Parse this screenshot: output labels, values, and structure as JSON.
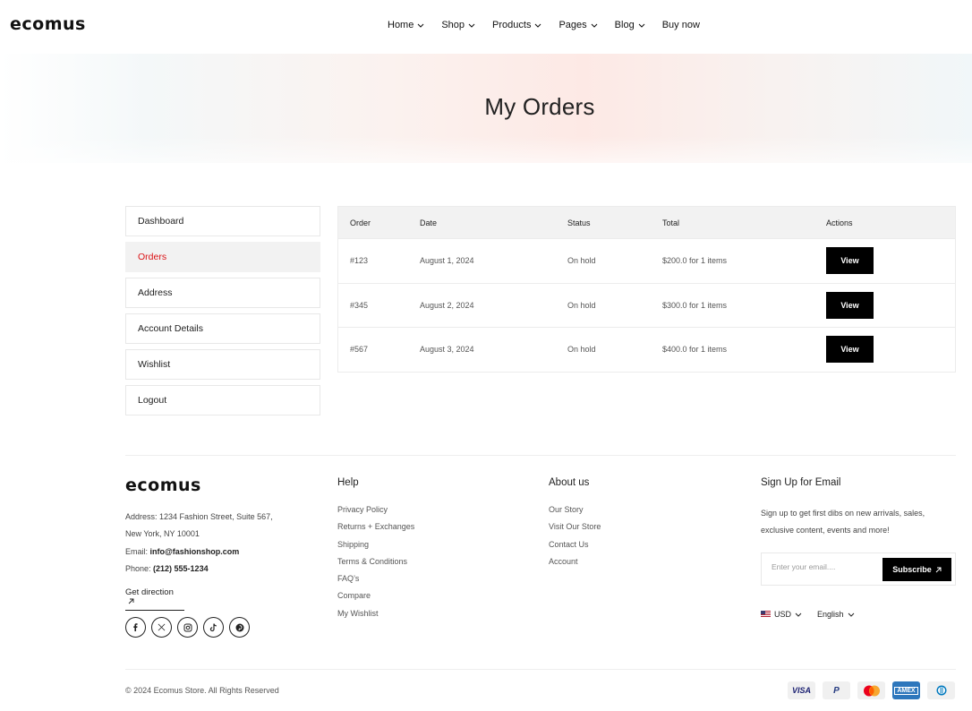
{
  "brand": {
    "logo_text": "ecomus"
  },
  "nav": {
    "items": [
      {
        "label": "Home",
        "has_dropdown": true
      },
      {
        "label": "Shop",
        "has_dropdown": true
      },
      {
        "label": "Products",
        "has_dropdown": true
      },
      {
        "label": "Pages",
        "has_dropdown": true
      },
      {
        "label": "Blog",
        "has_dropdown": true
      },
      {
        "label": "Buy now",
        "has_dropdown": false
      }
    ]
  },
  "hero": {
    "title": "My Orders"
  },
  "sidebar": {
    "items": [
      {
        "label": "Dashboard",
        "active": false
      },
      {
        "label": "Orders",
        "active": true
      },
      {
        "label": "Address",
        "active": false
      },
      {
        "label": "Account Details",
        "active": false
      },
      {
        "label": "Wishlist",
        "active": false
      },
      {
        "label": "Logout",
        "active": false
      }
    ],
    "active_color": "#db1215"
  },
  "orders_table": {
    "headers": {
      "order": "Order",
      "date": "Date",
      "status": "Status",
      "total": "Total",
      "actions": "Actions"
    },
    "rows": [
      {
        "order": "#123",
        "date": "August 1, 2024",
        "status": "On hold",
        "total": "$200.0 for 1 items",
        "action": "View"
      },
      {
        "order": "#345",
        "date": "August 2, 2024",
        "status": "On hold",
        "total": "$300.0 for 1 items",
        "action": "View"
      },
      {
        "order": "#567",
        "date": "August 3, 2024",
        "status": "On hold",
        "total": "$400.0 for 1 items",
        "action": "View"
      }
    ]
  },
  "footer": {
    "address": {
      "line1": "Address: 1234 Fashion Street, Suite 567,",
      "line2": "New York, NY 10001",
      "email_label": "Email: ",
      "email": "info@fashionshop.com",
      "phone_label": "Phone: ",
      "phone": "(212) 555-1234"
    },
    "get_direction": "Get direction",
    "socials": [
      "facebook-icon",
      "x-icon",
      "instagram-icon",
      "tiktok-icon",
      "pinterest-icon"
    ],
    "help": {
      "heading": "Help",
      "links": [
        "Privacy Policy",
        "Returns + Exchanges",
        "Shipping",
        "Terms & Conditions",
        "FAQ’s",
        "Compare",
        "My Wishlist"
      ]
    },
    "about": {
      "heading": "About us",
      "links": [
        "Our Story",
        "Visit Our Store",
        "Contact Us",
        "Account"
      ]
    },
    "signup": {
      "heading": "Sign Up for Email",
      "text": "Sign up to get first dibs on new arrivals, sales, exclusive content, events and more!",
      "placeholder": "Enter your email....",
      "button": "Subscribe"
    },
    "currency": "USD",
    "language": "English",
    "copyright": "© 2024 Ecomus Store. All Rights Reserved",
    "payments": [
      "VISA",
      "P",
      "mastercard",
      "AMEX",
      "diners"
    ]
  }
}
